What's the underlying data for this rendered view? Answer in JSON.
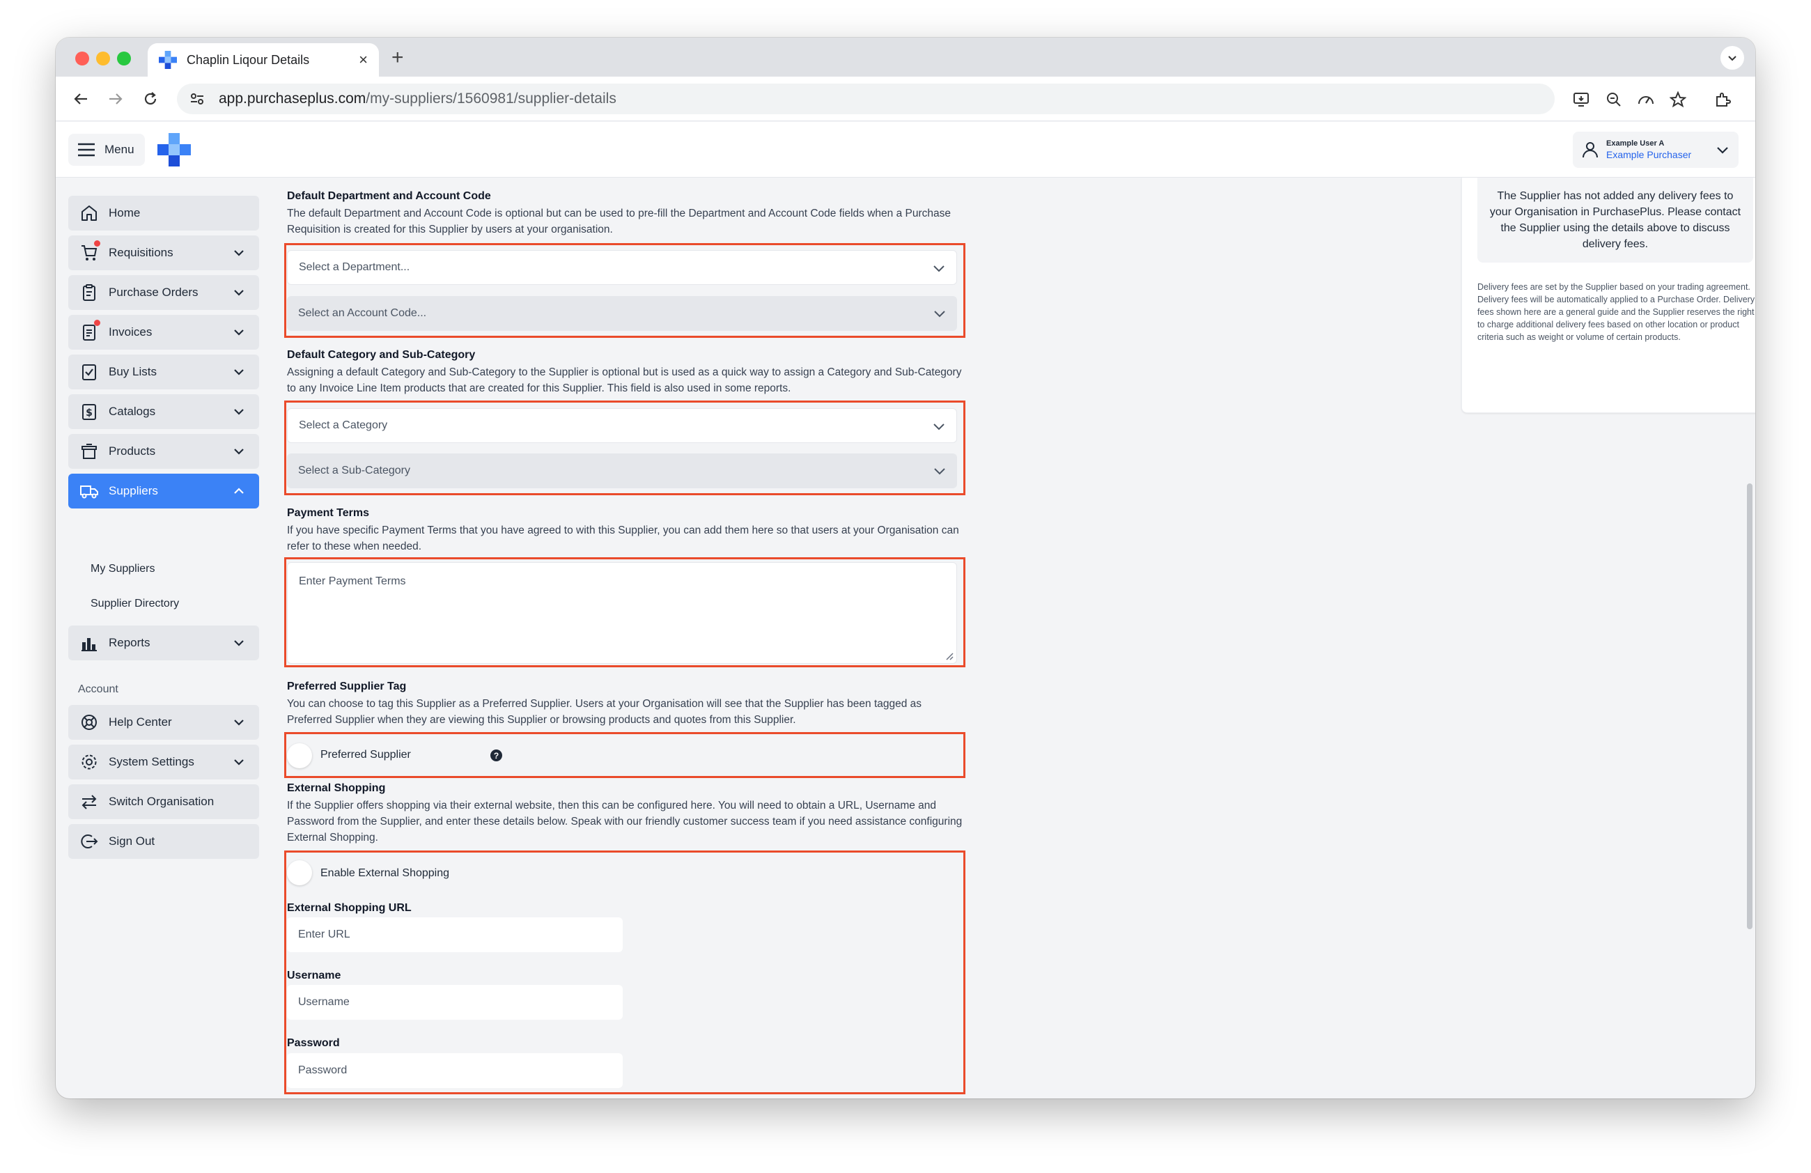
{
  "browser": {
    "tab_title": "Chaplin Liqour Details",
    "url_host": "app.purchaseplus.com",
    "url_path": "/my-suppliers/1560981/supplier-details"
  },
  "header": {
    "menu_label": "Menu",
    "user_name": "Example User A",
    "user_role": "Example Purchaser"
  },
  "sidebar": {
    "items": [
      {
        "label": "Home",
        "icon": "home-icon"
      },
      {
        "label": "Requisitions",
        "icon": "cart-icon"
      },
      {
        "label": "Purchase Orders",
        "icon": "clipboard-icon"
      },
      {
        "label": "Invoices",
        "icon": "invoice-icon"
      },
      {
        "label": "Buy Lists",
        "icon": "checklist-icon"
      },
      {
        "label": "Catalogs",
        "icon": "dollar-doc-icon"
      },
      {
        "label": "Products",
        "icon": "box-icon"
      },
      {
        "label": "Suppliers",
        "icon": "truck-icon"
      },
      {
        "label": "Reports",
        "icon": "bar-chart-icon"
      }
    ],
    "sub_items": [
      "My Suppliers",
      "Supplier Directory"
    ],
    "account_label": "Account",
    "account_items": [
      {
        "label": "Help Center",
        "icon": "lifebuoy-icon"
      },
      {
        "label": "System Settings",
        "icon": "gear-icon"
      },
      {
        "label": "Switch Organisation",
        "icon": "switch-icon"
      },
      {
        "label": "Sign Out",
        "icon": "sign-out-icon"
      }
    ]
  },
  "main": {
    "dept": {
      "title": "Default Department and Account Code",
      "desc": "The default Department and Account Code is optional but can be used to pre-fill the Department and Account Code fields when a Purchase Requisition is created for this Supplier by users at your organisation.",
      "dept_placeholder": "Select a Department...",
      "account_placeholder": "Select an Account Code..."
    },
    "category": {
      "title": "Default Category and Sub-Category",
      "desc": "Assigning a default Category and Sub-Category to the Supplier is optional but is used as a quick way to assign a Category and Sub-Category to any Invoice Line Item products that are created for this Supplier. This field is also used in some reports.",
      "category_placeholder": "Select a Category",
      "subcategory_placeholder": "Select a Sub-Category"
    },
    "payment": {
      "title": "Payment Terms",
      "desc": "If you have specific Payment Terms that you have agreed to with this Supplier, you can add them here so that users at your Organisation can refer to these when needed.",
      "placeholder": "Enter Payment Terms"
    },
    "preferred": {
      "title": "Preferred Supplier Tag",
      "desc": "You can choose to tag this Supplier as a Preferred Supplier. Users at your Organisation will see that the Supplier has been tagged as Preferred Supplier when they are viewing this Supplier or browsing products and quotes from this Supplier.",
      "toggle_label": "Preferred Supplier"
    },
    "external": {
      "title": "External Shopping",
      "desc": "If the Supplier offers shopping via their external website, then this can be configured here. You will need to obtain a URL, Username and Password from the Supplier, and enter these details below. Speak with our friendly customer success team if you need assistance configuring External Shopping.",
      "toggle_label": "Enable External Shopping",
      "url_label": "External Shopping URL",
      "url_placeholder": "Enter URL",
      "username_label": "Username",
      "username_placeholder": "Username",
      "password_label": "Password",
      "password_placeholder": "Password"
    }
  },
  "side_panel": {
    "info": "The Supplier has not added any delivery fees to your Organisation in PurchasePlus. Please contact the Supplier using the details above to discuss delivery fees.",
    "note": "Delivery fees are set by the Supplier based on your trading agreement. Delivery fees will be automatically applied to a Purchase Order. Delivery fees shown here are a general guide and the Supplier reserves the right to charge additional delivery fees based on other location or product criteria such as weight or volume of certain products."
  },
  "colors": {
    "accent": "#3b82f6",
    "highlight": "#ea4b2b",
    "user_role": "#2563eb"
  }
}
